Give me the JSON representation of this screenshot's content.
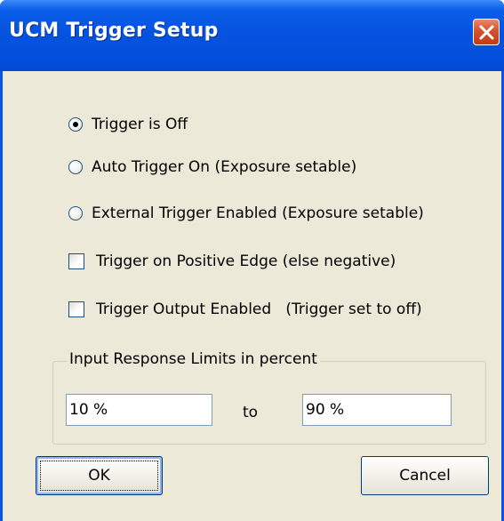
{
  "window": {
    "title": "UCM Trigger Setup",
    "close_icon": "close-icon"
  },
  "colors": {
    "titlebar": "#0553e0",
    "close_button": "#d8502f",
    "dialog_face": "#ece9d8",
    "control_border": "#1c5180",
    "textbox_border": "#7f9db9",
    "button_border": "#003c74"
  },
  "trigger_mode": {
    "options": [
      {
        "label": "Trigger is Off",
        "checked": true
      },
      {
        "label": "Auto Trigger On (Exposure setable)",
        "checked": false
      },
      {
        "label": "External Trigger Enabled (Exposure setable)",
        "checked": false
      }
    ]
  },
  "checkboxes": [
    {
      "label": "Trigger on Positive Edge (else negative)",
      "checked": false
    },
    {
      "label": "Trigger Output Enabled   (Trigger set to off)",
      "checked": false
    }
  ],
  "response_limits": {
    "group_label": "Input Response Limits in percent",
    "min_value": "10 %",
    "to_label": "to",
    "max_value": "90 %"
  },
  "buttons": {
    "ok_label": "OK",
    "cancel_label": "Cancel"
  }
}
